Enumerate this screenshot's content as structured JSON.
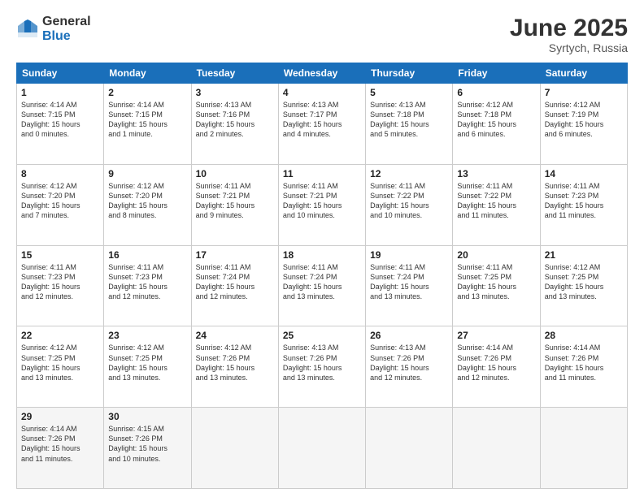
{
  "header": {
    "logo_general": "General",
    "logo_blue": "Blue",
    "month": "June 2025",
    "location": "Syrtych, Russia"
  },
  "weekdays": [
    "Sunday",
    "Monday",
    "Tuesday",
    "Wednesday",
    "Thursday",
    "Friday",
    "Saturday"
  ],
  "weeks": [
    [
      {
        "day": "1",
        "info": "Sunrise: 4:14 AM\nSunset: 7:15 PM\nDaylight: 15 hours\nand 0 minutes."
      },
      {
        "day": "2",
        "info": "Sunrise: 4:14 AM\nSunset: 7:15 PM\nDaylight: 15 hours\nand 1 minute."
      },
      {
        "day": "3",
        "info": "Sunrise: 4:13 AM\nSunset: 7:16 PM\nDaylight: 15 hours\nand 2 minutes."
      },
      {
        "day": "4",
        "info": "Sunrise: 4:13 AM\nSunset: 7:17 PM\nDaylight: 15 hours\nand 4 minutes."
      },
      {
        "day": "5",
        "info": "Sunrise: 4:13 AM\nSunset: 7:18 PM\nDaylight: 15 hours\nand 5 minutes."
      },
      {
        "day": "6",
        "info": "Sunrise: 4:12 AM\nSunset: 7:18 PM\nDaylight: 15 hours\nand 6 minutes."
      },
      {
        "day": "7",
        "info": "Sunrise: 4:12 AM\nSunset: 7:19 PM\nDaylight: 15 hours\nand 6 minutes."
      }
    ],
    [
      {
        "day": "8",
        "info": "Sunrise: 4:12 AM\nSunset: 7:20 PM\nDaylight: 15 hours\nand 7 minutes."
      },
      {
        "day": "9",
        "info": "Sunrise: 4:12 AM\nSunset: 7:20 PM\nDaylight: 15 hours\nand 8 minutes."
      },
      {
        "day": "10",
        "info": "Sunrise: 4:11 AM\nSunset: 7:21 PM\nDaylight: 15 hours\nand 9 minutes."
      },
      {
        "day": "11",
        "info": "Sunrise: 4:11 AM\nSunset: 7:21 PM\nDaylight: 15 hours\nand 10 minutes."
      },
      {
        "day": "12",
        "info": "Sunrise: 4:11 AM\nSunset: 7:22 PM\nDaylight: 15 hours\nand 10 minutes."
      },
      {
        "day": "13",
        "info": "Sunrise: 4:11 AM\nSunset: 7:22 PM\nDaylight: 15 hours\nand 11 minutes."
      },
      {
        "day": "14",
        "info": "Sunrise: 4:11 AM\nSunset: 7:23 PM\nDaylight: 15 hours\nand 11 minutes."
      }
    ],
    [
      {
        "day": "15",
        "info": "Sunrise: 4:11 AM\nSunset: 7:23 PM\nDaylight: 15 hours\nand 12 minutes."
      },
      {
        "day": "16",
        "info": "Sunrise: 4:11 AM\nSunset: 7:23 PM\nDaylight: 15 hours\nand 12 minutes."
      },
      {
        "day": "17",
        "info": "Sunrise: 4:11 AM\nSunset: 7:24 PM\nDaylight: 15 hours\nand 12 minutes."
      },
      {
        "day": "18",
        "info": "Sunrise: 4:11 AM\nSunset: 7:24 PM\nDaylight: 15 hours\nand 13 minutes."
      },
      {
        "day": "19",
        "info": "Sunrise: 4:11 AM\nSunset: 7:24 PM\nDaylight: 15 hours\nand 13 minutes."
      },
      {
        "day": "20",
        "info": "Sunrise: 4:11 AM\nSunset: 7:25 PM\nDaylight: 15 hours\nand 13 minutes."
      },
      {
        "day": "21",
        "info": "Sunrise: 4:12 AM\nSunset: 7:25 PM\nDaylight: 15 hours\nand 13 minutes."
      }
    ],
    [
      {
        "day": "22",
        "info": "Sunrise: 4:12 AM\nSunset: 7:25 PM\nDaylight: 15 hours\nand 13 minutes."
      },
      {
        "day": "23",
        "info": "Sunrise: 4:12 AM\nSunset: 7:25 PM\nDaylight: 15 hours\nand 13 minutes."
      },
      {
        "day": "24",
        "info": "Sunrise: 4:12 AM\nSunset: 7:26 PM\nDaylight: 15 hours\nand 13 minutes."
      },
      {
        "day": "25",
        "info": "Sunrise: 4:13 AM\nSunset: 7:26 PM\nDaylight: 15 hours\nand 13 minutes."
      },
      {
        "day": "26",
        "info": "Sunrise: 4:13 AM\nSunset: 7:26 PM\nDaylight: 15 hours\nand 12 minutes."
      },
      {
        "day": "27",
        "info": "Sunrise: 4:14 AM\nSunset: 7:26 PM\nDaylight: 15 hours\nand 12 minutes."
      },
      {
        "day": "28",
        "info": "Sunrise: 4:14 AM\nSunset: 7:26 PM\nDaylight: 15 hours\nand 11 minutes."
      }
    ],
    [
      {
        "day": "29",
        "info": "Sunrise: 4:14 AM\nSunset: 7:26 PM\nDaylight: 15 hours\nand 11 minutes."
      },
      {
        "day": "30",
        "info": "Sunrise: 4:15 AM\nSunset: 7:26 PM\nDaylight: 15 hours\nand 10 minutes."
      },
      null,
      null,
      null,
      null,
      null
    ]
  ]
}
